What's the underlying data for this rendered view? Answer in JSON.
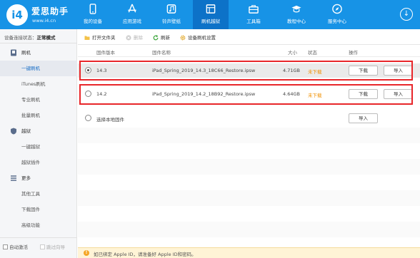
{
  "app": {
    "brand": "爱思助手",
    "url": "www.i4.cn",
    "logo_text": "i4"
  },
  "nav": [
    {
      "label": "我的设备",
      "icon": "phone-icon"
    },
    {
      "label": "应用游戏",
      "icon": "app-store-icon"
    },
    {
      "label": "铃声壁纸",
      "icon": "music-icon"
    },
    {
      "label": "刷机越狱",
      "icon": "flash-box-icon",
      "active": true
    },
    {
      "label": "工具箱",
      "icon": "toolbox-icon"
    },
    {
      "label": "教程中心",
      "icon": "graduation-cap-icon"
    },
    {
      "label": "服务中心",
      "icon": "compass-icon"
    }
  ],
  "sidebar": {
    "connection_label": "设备连接状态：",
    "connection_value": "正常模式",
    "items": [
      {
        "label": "刷机",
        "type": "section",
        "icon": "flash-icon"
      },
      {
        "label": "一键刷机",
        "type": "sub",
        "active": true
      },
      {
        "label": "iTunes刷机",
        "type": "sub"
      },
      {
        "label": "专业刷机",
        "type": "sub"
      },
      {
        "label": "批量刷机",
        "type": "sub"
      },
      {
        "label": "越狱",
        "type": "section",
        "icon": "shield-icon"
      },
      {
        "label": "一键越狱",
        "type": "sub"
      },
      {
        "label": "越狱插件",
        "type": "sub"
      },
      {
        "label": "更多",
        "type": "section",
        "icon": "menu-icon"
      },
      {
        "label": "其他工具",
        "type": "sub"
      },
      {
        "label": "下载固件",
        "type": "sub"
      },
      {
        "label": "高级功能",
        "type": "sub"
      }
    ],
    "auto_activate": "自动激活",
    "skip_guide": "跳过向导"
  },
  "toolbar": {
    "open_folder": "打开文件夹",
    "delete": "删除",
    "refresh": "刷新",
    "device_settings": "设备刷机设置"
  },
  "table": {
    "headers": {
      "version": "固件版本",
      "name": "固件名称",
      "size": "大小",
      "status": "状态",
      "actions": "操作"
    },
    "rows": [
      {
        "version": "14.3",
        "name": "iPad_Spring_2019_14.3_18C66_Restore.ipsw",
        "size": "4.71GB",
        "status": "未下载",
        "download": "下载",
        "import": "导入",
        "selected": true
      },
      {
        "version": "14.2",
        "name": "iPad_Spring_2019_14.2_18B92_Restore.ipsw",
        "size": "4.64GB",
        "status": "未下载",
        "download": "下载",
        "import": "导入",
        "selected": false
      }
    ],
    "local_firmware": "选择本地固件",
    "local_import": "导入"
  },
  "notice": {
    "text": "如已绑定 Apple ID，请准备好 Apple ID和密码。"
  },
  "colors": {
    "header_blue": "#1793e6",
    "status_orange": "#f09000",
    "highlight_red": "#e8262a"
  }
}
